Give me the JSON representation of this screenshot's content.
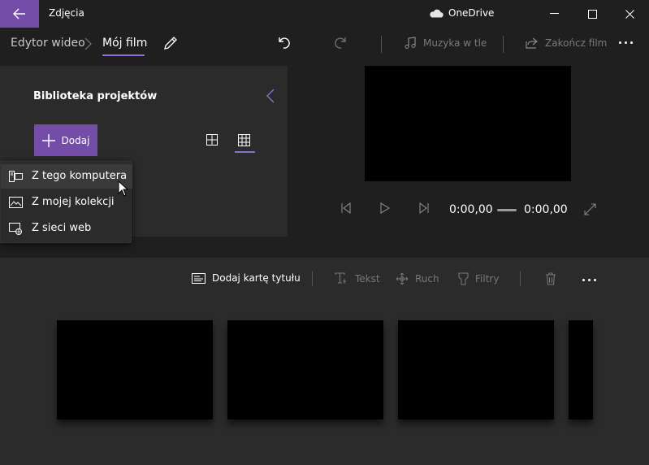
{
  "titlebar": {
    "app_title": "Zdjęcia",
    "onedrive_label": "OneDrive",
    "accent_color": "#744da9"
  },
  "breadcrumb": {
    "root": "Edytor wideo",
    "current": "Mój film"
  },
  "toolbar": {
    "music_label": "Muzyka w tle",
    "finish_label": "Zakończ film"
  },
  "library": {
    "title": "Biblioteka projektów",
    "add_label": "Dodaj"
  },
  "add_menu": {
    "items": [
      {
        "label": "Z tego komputera",
        "icon": "computer-icon"
      },
      {
        "label": "Z mojej kolekcji",
        "icon": "collection-icon"
      },
      {
        "label": "Z sieci web",
        "icon": "web-icon"
      }
    ]
  },
  "player": {
    "current_time": "0:00,00",
    "total_time": "0:00,00"
  },
  "storyboard": {
    "add_title_card_label": "Dodaj kartę tytułu",
    "text_label": "Tekst",
    "motion_label": "Ruch",
    "filters_label": "Filtry"
  }
}
